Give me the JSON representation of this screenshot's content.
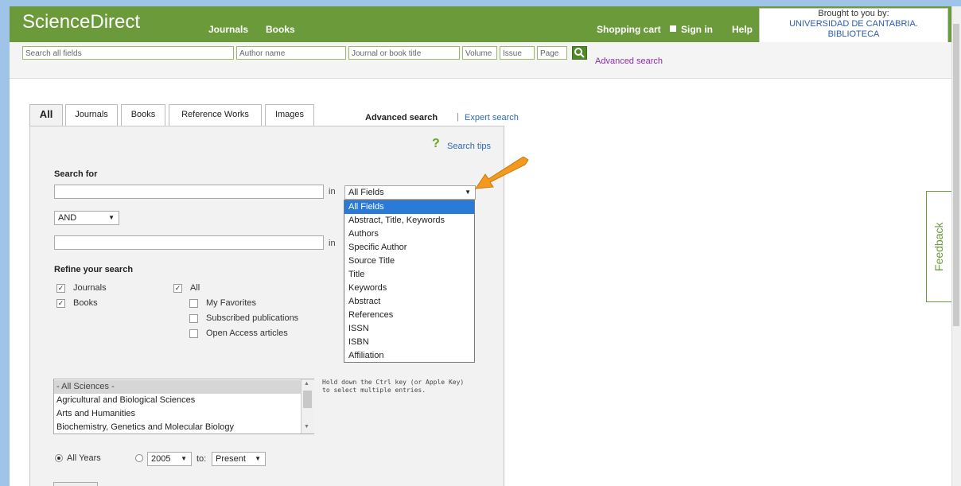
{
  "header": {
    "logo": "ScienceDirect",
    "nav": [
      "Journals",
      "Books"
    ],
    "shopping_cart": "Shopping cart",
    "sign_in": "Sign in",
    "help": "Help",
    "brought_to_you_by": "Brought to you by:",
    "institution_line1": "UNIVERSIDAD DE CANTABRIA.",
    "institution_line2": "BIBLIOTECA"
  },
  "quick_search": {
    "all_fields_placeholder": "Search all fields",
    "author_placeholder": "Author name",
    "journal_placeholder": "Journal or book title",
    "volume_placeholder": "Volume",
    "issue_placeholder": "Issue",
    "page_placeholder": "Page",
    "advanced_link": "Advanced search"
  },
  "tabs": [
    "All",
    "Journals",
    "Books",
    "Reference Works",
    "Images"
  ],
  "search_mode": {
    "advanced": "Advanced search",
    "separator": "|",
    "expert": "Expert search"
  },
  "search_tips": "Search tips",
  "form": {
    "search_for_label": "Search for",
    "in_label": "in",
    "field_selected": "All Fields",
    "operator_selected": "AND",
    "refine_label": "Refine your search"
  },
  "field_options": [
    "All Fields",
    "Abstract, Title, Keywords",
    "Authors",
    "Specific Author",
    "Source Title",
    "Title",
    "Keywords",
    "Abstract",
    "References",
    "ISSN",
    "ISBN",
    "Affiliation"
  ],
  "content_types": [
    {
      "label": "Journals",
      "checked": true
    },
    {
      "label": "Books",
      "checked": true
    }
  ],
  "access_filters": [
    {
      "label": "All",
      "checked": true
    },
    {
      "label": "My Favorites",
      "checked": false
    },
    {
      "label": "Subscribed publications",
      "checked": false
    },
    {
      "label": "Open Access articles",
      "checked": false
    }
  ],
  "subjects": [
    "- All Sciences -",
    "Agricultural and Biological Sciences",
    "Arts and Humanities",
    "Biochemistry, Genetics and Molecular Biology"
  ],
  "subject_hint_line1": "Hold down the Ctrl key (or Apple Key)",
  "subject_hint_line2": "to select multiple entries.",
  "years": {
    "all_years_label": "All Years",
    "from_year": "2005",
    "to_label": "to:",
    "to_value": "Present"
  },
  "feedback": "Feedback",
  "colors": {
    "brand_green": "#6a9a3a",
    "link_blue": "#2a6ab8",
    "selection_blue": "#2a7bd8",
    "arrow_orange": "#f39a1e"
  }
}
